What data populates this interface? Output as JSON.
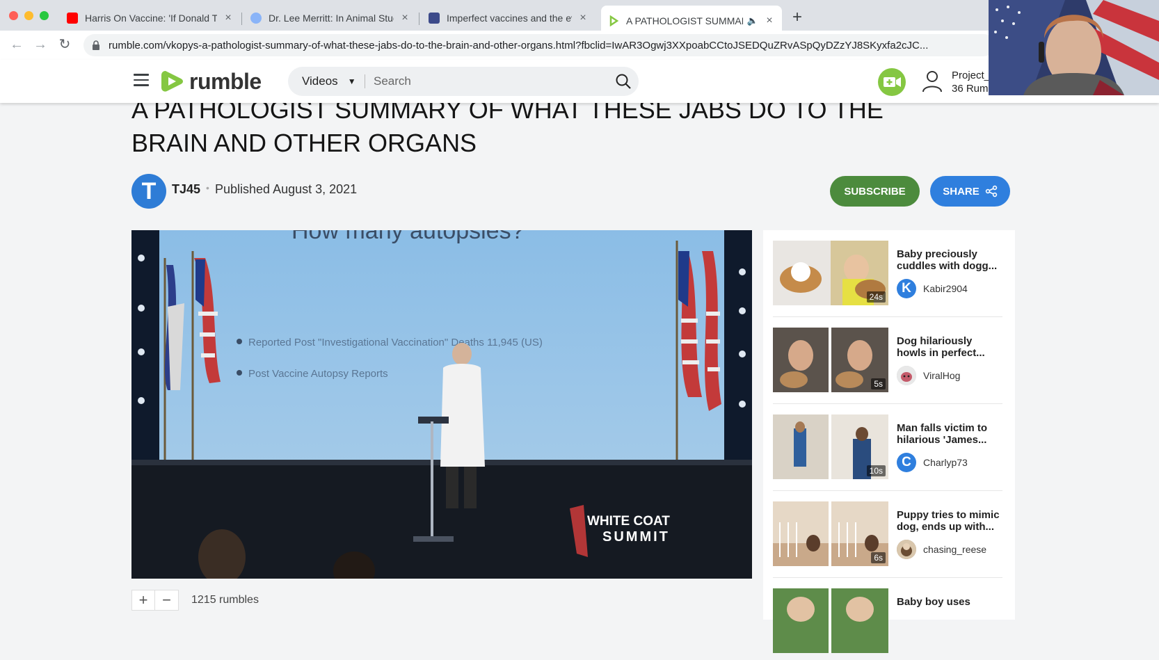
{
  "browser": {
    "tabs": [
      {
        "title": "Harris On Vaccine: 'If Donald T",
        "favicon_color": "#ff0000",
        "active": false
      },
      {
        "title": "Dr. Lee Merritt: In Animal Stud",
        "favicon_color": "#8ab4f8",
        "active": false
      },
      {
        "title": "Imperfect vaccines and the ev",
        "favicon_color": "#3c4a8a",
        "active": false
      },
      {
        "title": "A PATHOLOGIST SUMMAR",
        "favicon_color": "#85c742",
        "active": true
      }
    ],
    "close_glyph": "×",
    "new_tab_glyph": "+",
    "url": "rumble.com/vkopys-a-pathologist-summary-of-what-these-jabs-do-to-the-brain-and-other-organs.html?fbclid=IwAR3Ogwj3XXpoabCCtoJSEDQuZRvASpQyDZzYJ8SKyxfa2cJC..."
  },
  "header": {
    "logo_text": "rumble",
    "search_category": "Videos",
    "search_placeholder": "Search",
    "user_name": "Project_",
    "user_sub": "36 Rum"
  },
  "video": {
    "title": "A PATHOLOGIST SUMMARY OF WHAT THESE JABS DO TO THE BRAIN AND OTHER ORGANS",
    "channel_initial": "T",
    "channel": "TJ45",
    "published": "Published August 3, 2021",
    "subscribe_label": "SUBSCRIBE",
    "share_label": "SHARE",
    "slide_heading": "How many autopsies?",
    "slide_bullets": [
      "Reported Post \"Investigational Vaccination\" Deaths 11,945 (US)",
      "Post Vaccine Autopsy Reports"
    ],
    "watermark_line1": "WHITE COAT",
    "watermark_line2": "SUMMIT",
    "rumbles": "1215 rumbles",
    "plus": "+",
    "minus": "−"
  },
  "related": [
    {
      "title": "Baby preciously cuddles with dogg...",
      "channel": "Kabir2904",
      "initial": "K",
      "avatar_color": "#2f7fde",
      "duration": "24s"
    },
    {
      "title": "Dog hilariously howls in perfect...",
      "channel": "ViralHog",
      "initial": "",
      "avatar_color": "#c0c4c8",
      "duration": "5s"
    },
    {
      "title": "Man falls victim to hilarious 'James...",
      "channel": "Charlyp73",
      "initial": "C",
      "avatar_color": "#2f7fde",
      "duration": "10s"
    },
    {
      "title": "Puppy tries to mimic dog, ends up with...",
      "channel": "chasing_reese",
      "initial": "",
      "avatar_color": "#a08970",
      "duration": "6s"
    },
    {
      "title": "Baby boy uses",
      "channel": "",
      "initial": "",
      "avatar_color": "#ffffff",
      "duration": ""
    }
  ]
}
